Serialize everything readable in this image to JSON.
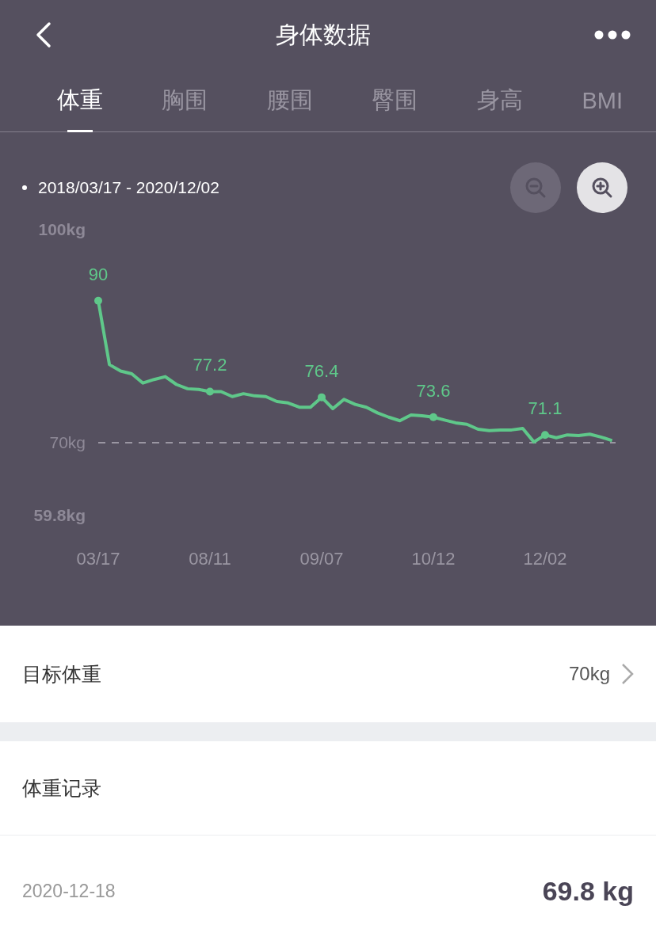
{
  "header": {
    "title": "身体数据"
  },
  "tabs": [
    {
      "label": "体重",
      "selected": true
    },
    {
      "label": "胸围",
      "selected": false
    },
    {
      "label": "腰围",
      "selected": false
    },
    {
      "label": "臀围",
      "selected": false
    },
    {
      "label": "身高",
      "selected": false
    },
    {
      "label": "BMI",
      "selected": false
    }
  ],
  "chart": {
    "range": "2018/03/17 - 2020/12/02",
    "zoom_out": {
      "disabled": true
    },
    "zoom_in": {
      "disabled": false
    },
    "chart_data": {
      "type": "line",
      "categories": [
        "03/17",
        null,
        null,
        null,
        null,
        null,
        null,
        null,
        null,
        null,
        "08/11",
        null,
        null,
        null,
        null,
        null,
        null,
        null,
        null,
        null,
        "09/07",
        null,
        null,
        null,
        null,
        null,
        null,
        null,
        null,
        null,
        "10/12",
        null,
        null,
        null,
        null,
        null,
        null,
        null,
        null,
        null,
        "12/02",
        null,
        null,
        null,
        null,
        null,
        null
      ],
      "series": [
        {
          "color": "#5fc88a",
          "marker": "none",
          "values": [
            90,
            81.0,
            80.1,
            79.7,
            78.4,
            78.9,
            79.3,
            78.2,
            77.6,
            77.5,
            77.2,
            77.2,
            76.5,
            76.9,
            76.6,
            76.5,
            75.8,
            75.6,
            75.0,
            75.0,
            76.4,
            74.8,
            76.1,
            75.4,
            75.0,
            74.2,
            73.6,
            73.1,
            73.9,
            73.8,
            73.6,
            73.2,
            72.8,
            72.6,
            71.9,
            71.7,
            71.8,
            71.8,
            72.0,
            70.1,
            71.1,
            70.7,
            71.1,
            71.0,
            71.2,
            70.8,
            70.3
          ]
        }
      ],
      "ylim": [
        59.8,
        100
      ],
      "yticks": [
        {
          "value": 100,
          "label": "100kg"
        },
        {
          "value": 70,
          "label": "70kg"
        },
        {
          "value": 59.8,
          "label": "59.8kg"
        }
      ],
      "annotations": [
        {
          "x": "03/17",
          "y": 90,
          "text": "90"
        },
        {
          "x": "08/11",
          "y": 77.2,
          "text": "77.2"
        },
        {
          "x": "09/07",
          "y": 76.4,
          "text": "76.4"
        },
        {
          "x": "10/12",
          "y": 73.6,
          "text": "73.6"
        },
        {
          "x": "12/02",
          "y": 71.1,
          "text": "71.1"
        }
      ]
    }
  },
  "goal": {
    "label": "目标体重",
    "value": "70kg"
  },
  "records": {
    "title": "体重记录",
    "items": [
      {
        "date": "2020-12-18",
        "weight": "69.8 kg"
      }
    ]
  }
}
